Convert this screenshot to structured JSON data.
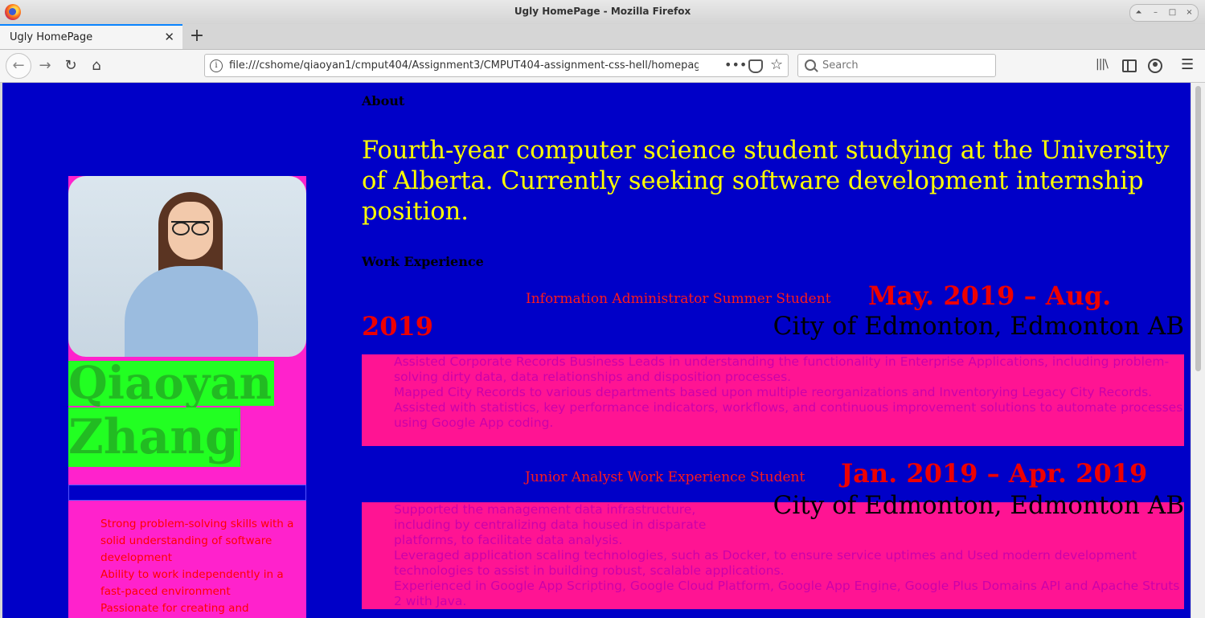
{
  "browser": {
    "window_title": "Ugly HomePage - Mozilla Firefox",
    "tab_title": "Ugly HomePage",
    "url": "file:///cshome/qiaoyan1/cmput404/Assignment3/CMPUT404-assignment-css-hell/homepage",
    "search_placeholder": "Search",
    "controls": {
      "up": "⏶",
      "minimize": "–",
      "maximize": "□",
      "close": "×"
    },
    "tab_close": "✕",
    "new_tab": "+",
    "more": "•••"
  },
  "profile": {
    "first_name": "Qiaoyan",
    "last_name": "Zhang",
    "skills": [
      "Strong problem-solving skills with a solid understanding of software development",
      "Ability to work independently in a fast-paced environment",
      "Passionate for creating and"
    ]
  },
  "about": {
    "heading": "About",
    "text": "Fourth-year computer science student studying at the University of Alberta. Currently seeking software development internship position."
  },
  "work": {
    "heading": "Work Experience",
    "jobs": [
      {
        "title": "Information Administrator Summer Student",
        "dates_part1": "May. 2019 – Aug.",
        "dates_part2": "2019",
        "org": "City of Edmonton, Edmonton AB",
        "bullets": [
          "Assisted Corporate Records Business Leads in understanding the functionality in Enterprise Applications, including problem-solving dirty data, data relationships and disposition processes.",
          "Mapped City Records to various departments based upon multiple reorganizations and Inventorying Legacy City Records.",
          "Assisted with statistics, key performance indicators, workflows, and continuous improvement solutions to automate processes using Google App coding."
        ]
      },
      {
        "title": "Junior Analyst Work Experience Student",
        "dates": "Jan. 2019 – Apr. 2019",
        "org": "City of Edmonton, Edmonton AB",
        "bullets": [
          "Supported the management data infrastructure, including by centralizing data housed in disparate platforms, to facilitate data analysis.",
          "Leveraged application scaling technologies, such as Docker, to ensure service uptimes and Used modern development technologies to assist in building robust, scalable applications.",
          "Experienced in Google App Scripting, Google Cloud Platform, Google App Engine, Google Plus Domains API and Apache Struts 2 with Java."
        ]
      }
    ]
  }
}
